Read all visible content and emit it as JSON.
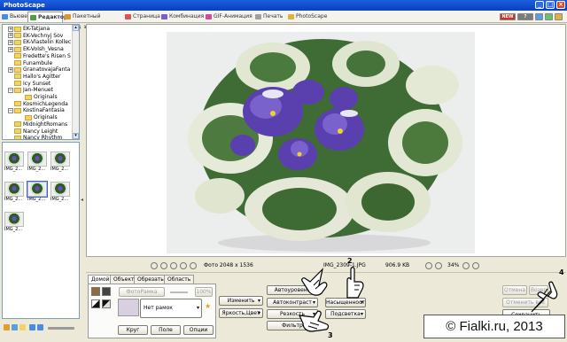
{
  "window": {
    "title": "PhotoScape"
  },
  "tabs": [
    {
      "label": "Вьювер",
      "color": "#4a8de0"
    },
    {
      "label": "Редактор",
      "color": "#4f9f3a",
      "active": true
    },
    {
      "label": "Пакетный редактор",
      "color": "#d9962e"
    },
    {
      "label": "Страница",
      "color": "#e05050"
    },
    {
      "label": "Комбинация",
      "color": "#7a5fc9"
    },
    {
      "label": "GIF-Анимация",
      "color": "#d04b9a"
    },
    {
      "label": "Печать",
      "color": "#a0a0a0"
    },
    {
      "label": "PhotoScape",
      "color": "#e2b13a"
    }
  ],
  "tree": {
    "items": [
      {
        "label": "EK-Tatjana",
        "expander": "+"
      },
      {
        "label": "EK-Vechnyj Sov",
        "expander": "+"
      },
      {
        "label": "EK-Vlastelin Kollec",
        "expander": "+"
      },
      {
        "label": "EK-Volsh_Vesna",
        "expander": "+"
      },
      {
        "label": "Fredette's Risen S",
        "expander": ""
      },
      {
        "label": "Funambule",
        "expander": ""
      },
      {
        "label": "GranatovajaFanta",
        "expander": "+"
      },
      {
        "label": "Hallo's Agitter",
        "expander": ""
      },
      {
        "label": "Icy Sunset",
        "expander": ""
      },
      {
        "label": "Jan-Menuet",
        "expander": "−"
      },
      {
        "label": "Originals",
        "expander": "",
        "indent": true
      },
      {
        "label": "KosmichLegenda",
        "expander": ""
      },
      {
        "label": "KostinaFantasia",
        "expander": "−"
      },
      {
        "label": "Originals",
        "expander": "",
        "indent": true
      },
      {
        "label": "MidnightRomans",
        "expander": ""
      },
      {
        "label": "Nancy Leight",
        "expander": ""
      },
      {
        "label": "Nancy Rhythm",
        "expander": ""
      }
    ]
  },
  "thumbnails": [
    {
      "caption": "IMG_2..."
    },
    {
      "caption": "IMG_2..."
    },
    {
      "caption": "IMG_2..."
    },
    {
      "caption": "IMG_2..."
    },
    {
      "caption": "IMG_2..."
    },
    {
      "caption": "IMG_2..."
    },
    {
      "caption": "IMG_2..."
    }
  ],
  "status": {
    "photo_size": "Фото 2048 x 1536",
    "filename": "IMG_2309-1.JPG",
    "filesize": "906.9 KB",
    "zoom": "34%"
  },
  "panel": {
    "tabs": [
      "Домой",
      "Объект",
      "Обрезать",
      "Область"
    ],
    "photo_frame": "ФотоРамка",
    "frame_percent": "100%",
    "frame_select": "Нет рамок",
    "buttons": {
      "circle": "Круг",
      "field": "Поле",
      "options": "Опции",
      "resize": "Изменить",
      "bright_color": "Яркость,Цвет",
      "auto_level": "Автоуровень",
      "auto_contrast": "Автоконтраст",
      "saturation": "Насыщенность",
      "sharpen": "Резкость",
      "backlight": "Подсветка",
      "filter": "Фильтр",
      "undo": "Отмена",
      "redo": "Возвр",
      "undo_all": "Отменить все",
      "save": "Сохранить"
    }
  },
  "annotations": [
    "2",
    "3",
    "4"
  ],
  "watermark": "© Fialki.ru, 2013"
}
